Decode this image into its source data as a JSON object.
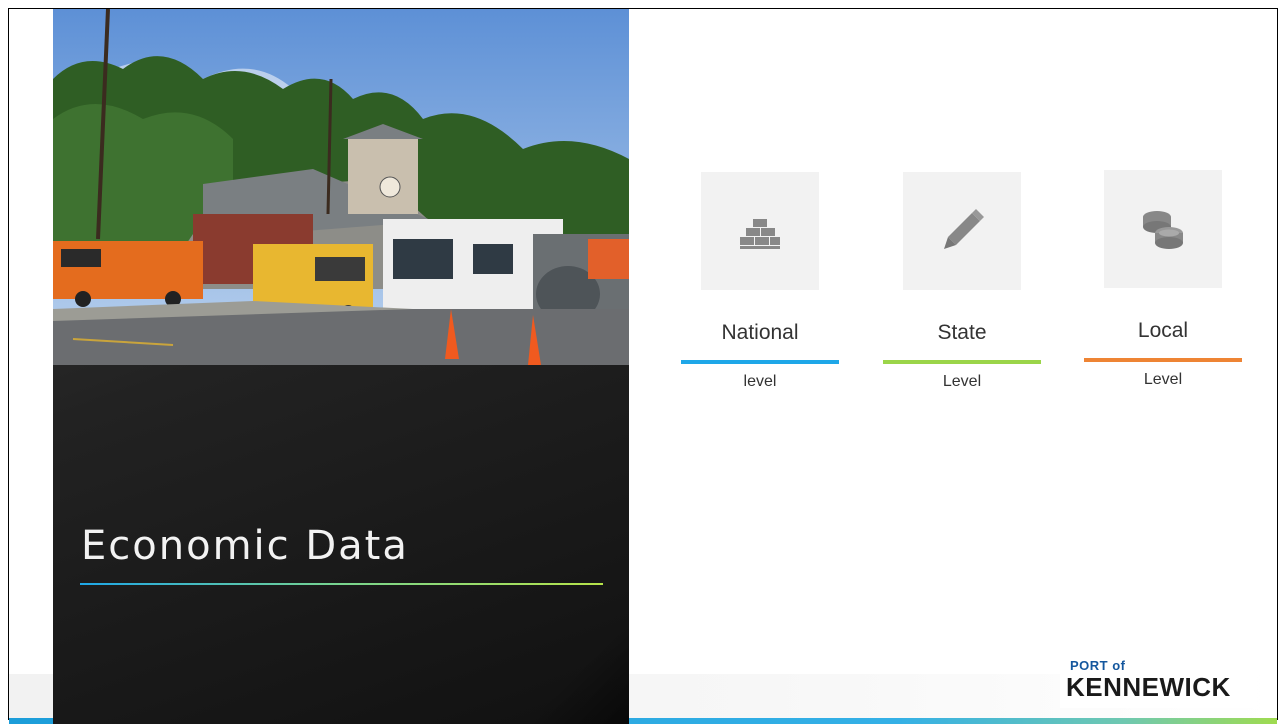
{
  "slide": {
    "title": "Economic Data",
    "photo_alt": "Food trucks parked in front of a building"
  },
  "tiles": [
    {
      "label": "National",
      "sub": "level",
      "icon": "gold-bars-icon",
      "color": "#1ea7e8"
    },
    {
      "label": "State",
      "sub": "Level",
      "icon": "pencil-icon",
      "color": "#9bd549"
    },
    {
      "label": "Local",
      "sub": "Level",
      "icon": "coins-icon",
      "color": "#ee8434"
    }
  ],
  "logo": {
    "top": "PORT of",
    "main": "KENNEWICK"
  }
}
